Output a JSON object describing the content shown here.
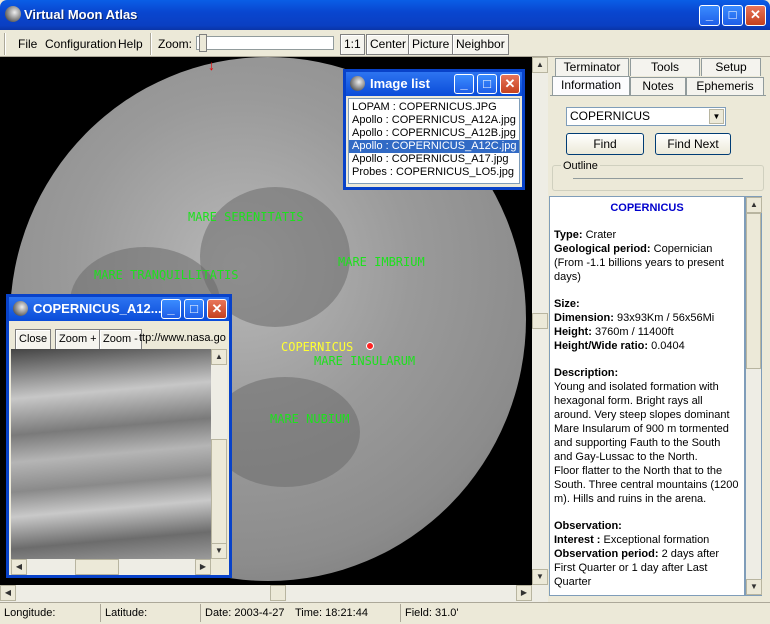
{
  "app": {
    "title": "Virtual Moon Atlas"
  },
  "menu": {
    "file": "File",
    "configuration": "Configuration",
    "help": "Help"
  },
  "toolbar": {
    "zoom_label": "Zoom:",
    "one_to_one": "1:1",
    "center": "Center",
    "picture": "Picture",
    "neighbor": "Neighbor"
  },
  "moon_labels": {
    "serenitatis": "MARE SERENITATIS",
    "tranquillitatis": "MARE TRANQUILLITATIS",
    "imbrium": "MARE IMBRIUM",
    "copernicus": "COPERNICUS",
    "insularum": "MARE INSULARUM",
    "nubium": "MARE NUBIUM"
  },
  "image_list": {
    "title": "Image list",
    "items": [
      "LOPAM : COPERNICUS.JPG",
      "Apollo : COPERNICUS_A12A.jpg",
      "Apollo : COPERNICUS_A12B.jpg",
      "Apollo : COPERNICUS_A12C.jpg",
      "Apollo : COPERNICUS_A17.jpg",
      "Probes : COPERNICUS_LO5.jpg"
    ],
    "selected_index": 3
  },
  "image_viewer": {
    "title": "COPERNICUS_A12...",
    "close": "Close",
    "zoom_in": "Zoom +",
    "zoom_out": "Zoom -",
    "url": "ttp://www.nasa.go"
  },
  "tabs": {
    "terminator": "Terminator",
    "tools": "Tools",
    "setup": "Setup",
    "information": "Information",
    "notes": "Notes",
    "ephemeris": "Ephemeris"
  },
  "search": {
    "value": "COPERNICUS",
    "find": "Find",
    "find_next": "Find Next",
    "outline": "Outline"
  },
  "info": {
    "name": "COPERNICUS",
    "type_label": "Type:",
    "type_value": " Crater",
    "geo_label": "Geological period:",
    "geo_value": " Copernician",
    "geo_note": "(From -1.1 billions years to present days)",
    "size_head": "Size:",
    "dim_label": "Dimension:",
    "dim_value": " 93x93Km / 56x56Mi",
    "height_label": "Height:",
    "height_value": " 3760m / 11400ft",
    "ratio_label": "Height/Wide ratio:",
    "ratio_value": " 0.0404",
    "desc_head": "Description:",
    "desc_1": "Young and isolated formation with hexagonal form. Bright rays all around. Very steep slopes dominant Mare Insularum of 900 m tormented and supporting Fauth to the South and Gay-Lussac to the North.",
    "desc_2": "Floor flatter to the North that to the South. Three central mountains (1200 m). Hills and ruins in the arena.",
    "obs_head": "Observation:",
    "interest_label": "Interest :",
    "interest_value": " Exceptional formation",
    "period_label": "Observation period:",
    "period_value": " 2 days after First Quarter or 1 day after Last Quarter"
  },
  "status": {
    "longitude": "Longitude:",
    "latitude": "Latitude:",
    "date": "Date: 2003-4-27",
    "time": "Time: 18:21:44",
    "field": "Field: 31.0'"
  }
}
